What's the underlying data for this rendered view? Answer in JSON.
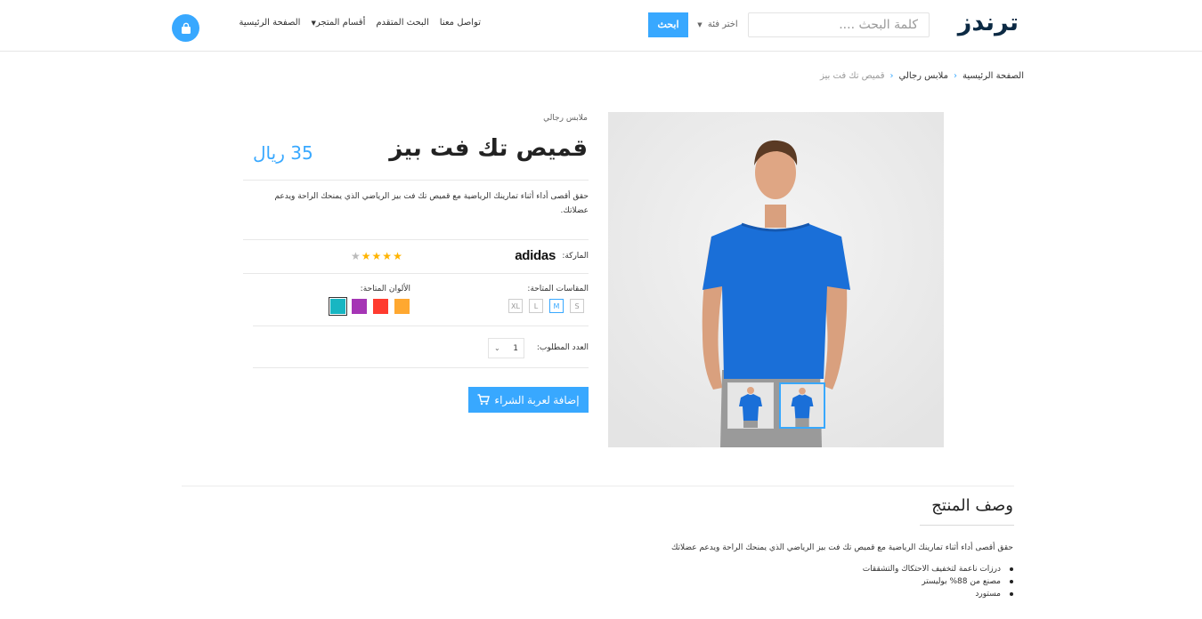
{
  "header": {
    "logo": "ترندز",
    "search_placeholder": "كلمة البحث ....",
    "category_select": "اختر فئة",
    "search_button": "ابحث",
    "nav": {
      "home": "الصفحة الرئيسية",
      "store_sections": "أقسام المتجر",
      "advanced_search": "البحث المتقدم",
      "contact": "تواصل معنا"
    }
  },
  "breadcrumb": {
    "home": "الصفحة الرئيسية",
    "category": "ملابس رجالي",
    "current": "قميص تك فت بيز"
  },
  "product": {
    "category": "ملابس رجالي",
    "title": "قميص تك فت بيز",
    "price": "35 ريال",
    "short_description": "حقق أقصى أداء أثناء تمارينك الرياضية مع قميص تك فت بيز الرياضي الذي يمنحك الراحة ويدعم عضلاتك.",
    "brand_label": "الماركة:",
    "brand_name": "adidas",
    "rating": 4,
    "rating_max": 5,
    "sizes_label": "المقاسات المتاحة:",
    "sizes": [
      "S",
      "M",
      "L",
      "XL"
    ],
    "selected_size": "M",
    "colors_label": "الألوان المتاحة:",
    "colors": [
      "#ffa830",
      "#ff3b2f",
      "#a535b5",
      "#18b6c2"
    ],
    "selected_color": "#18b6c2",
    "quantity_label": "العدد المطلوب:",
    "quantity": "1",
    "add_to_cart": "إضافة لعربة الشراء"
  },
  "description_section": {
    "title": "وصف المنتج",
    "text": "حقق أقصى أداء أثناء تمارينك الرياضية مع قميص تك فت بيز الرياضي الذي يمنحك الراحة ويدعم عضلاتك",
    "features": [
      "درزات ناعمة لتخفيف الاحتكاك والتشققات",
      "مصنع من 88% بوليستر",
      "مستورد"
    ]
  },
  "colors": {
    "accent": "#38a8ff",
    "logo": "#0c2a44",
    "star": "#ffb400"
  }
}
